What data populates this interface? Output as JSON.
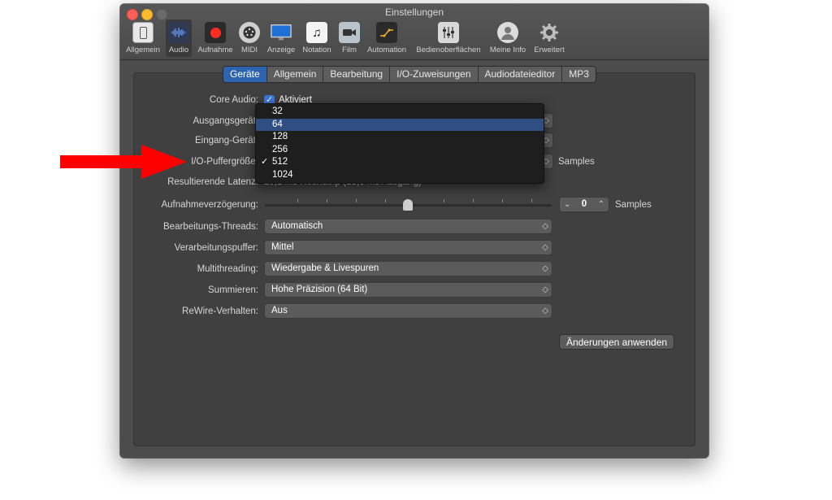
{
  "window": {
    "title": "Einstellungen"
  },
  "toolbar": [
    {
      "label": "Allgemein",
      "icon": "switch-icon"
    },
    {
      "label": "Audio",
      "icon": "waveform-icon",
      "selected": true
    },
    {
      "label": "Aufnahme",
      "icon": "record-icon"
    },
    {
      "label": "MIDI",
      "icon": "midi-icon"
    },
    {
      "label": "Anzeige",
      "icon": "display-icon"
    },
    {
      "label": "Notation",
      "icon": "notation-icon"
    },
    {
      "label": "Film",
      "icon": "film-icon"
    },
    {
      "label": "Automation",
      "icon": "automation-icon"
    },
    {
      "label": "Bedienoberflächen",
      "icon": "control-surface-icon"
    },
    {
      "label": "Meine Info",
      "icon": "user-icon"
    },
    {
      "label": "Erweitert",
      "icon": "gear-icon"
    }
  ],
  "tabs": [
    "Geräte",
    "Allgemein",
    "Bearbeitung",
    "I/O-Zuweisungen",
    "Audiodateieditor",
    "MP3"
  ],
  "active_tab": "Geräte",
  "form": {
    "core_audio_label": "Core Audio:",
    "core_audio_value": "Aktiviert",
    "output_label": "Ausgangsgerät:",
    "input_label": "Eingang-Gerät:",
    "buffer_label": "I/O-Puffergröße:",
    "buffer_unit": "Samples",
    "latency_label": "Resultierende Latenz:",
    "latency_value": "29,1 ms Roundtrip (13,6 ms Ausgang)",
    "recording_delay_label": "Aufnahmeverzögerung:",
    "recording_delay_value": "0",
    "recording_delay_unit": "Samples",
    "threads_label": "Bearbeitungs-Threads:",
    "threads_value": "Automatisch",
    "process_buffer_label": "Verarbeitungspuffer:",
    "process_buffer_value": "Mittel",
    "multithreading_label": "Multithreading:",
    "multithreading_value": "Wiedergabe & Livespuren",
    "summing_label": "Summieren:",
    "summing_value": "Hohe Präzision (64 Bit)",
    "rewire_label": "ReWire-Verhalten:",
    "rewire_value": "Aus",
    "apply_button": "Änderungen anwenden"
  },
  "buffer_dropdown": {
    "options": [
      "32",
      "64",
      "128",
      "256",
      "512",
      "1024"
    ],
    "checked": "512",
    "highlighted": "64"
  },
  "annotation": {
    "arrow_color": "#ff0000"
  },
  "colors": {
    "accent": "#2d64b2",
    "window_bg": "#4c4c4c"
  }
}
